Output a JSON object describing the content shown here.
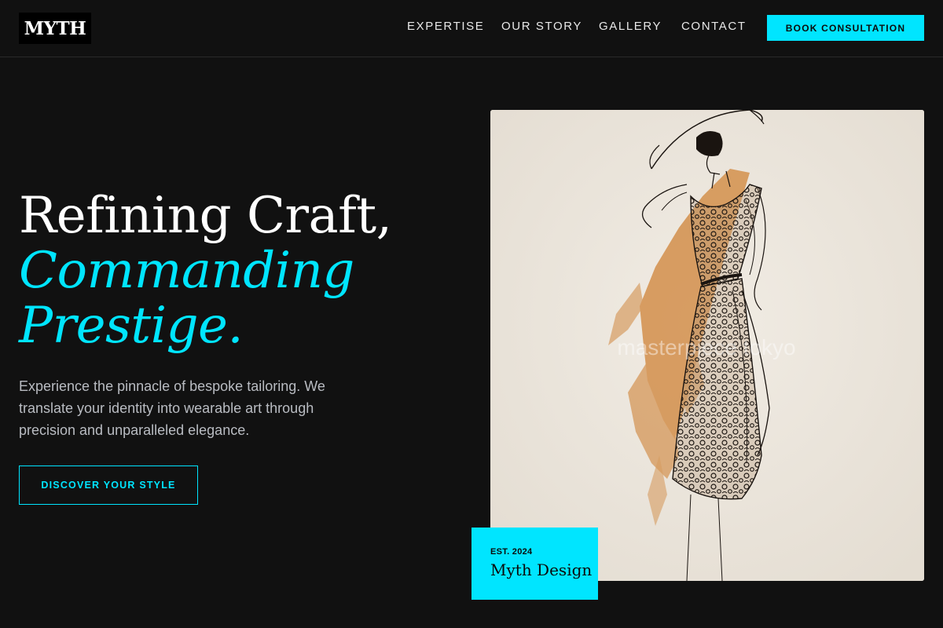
{
  "header": {
    "logo": "MYTH",
    "nav": [
      {
        "label": "EXPERTISE"
      },
      {
        "label": "OUR STORY"
      },
      {
        "label": "GALLERY"
      },
      {
        "label": "CONTACT"
      }
    ],
    "cta_label": "BOOK CONSULTATION"
  },
  "hero": {
    "headline_line1": "Refining Craft,",
    "headline_accent_line1": "Commanding",
    "headline_accent_line2": "Prestige.",
    "description": "Experience the pinnacle of bespoke tailoring. We translate your identity into wearable art through precision and unparalleled elegance.",
    "cta_label": "DISCOVER YOUR STYLE"
  },
  "feature_image": {
    "watermark": "masterpiece tokyo",
    "badge": {
      "label": "EST. 2024",
      "name": "Myth Design"
    }
  },
  "colors": {
    "background": "#111111",
    "accent": "#00e5ff",
    "text": "#ffffff",
    "muted_text": "#b9bcc2",
    "image_paper": "#ebe5dc",
    "watercolor": "#d28c46"
  },
  "icons": [
    "fashion-sketch-illustration"
  ]
}
